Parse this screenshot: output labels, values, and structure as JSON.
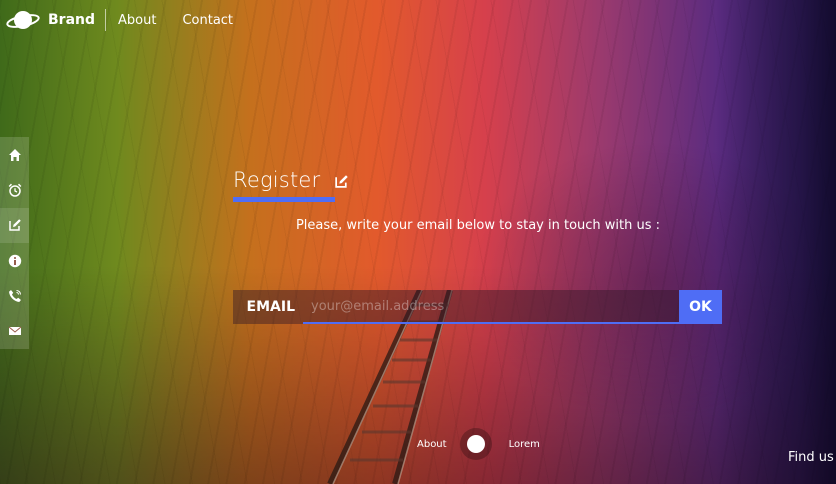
{
  "brand": {
    "name": "Brand",
    "logo": "planet-icon"
  },
  "nav": {
    "links": [
      "About",
      "Contact"
    ]
  },
  "sidebar": {
    "items": [
      {
        "icon": "home-icon"
      },
      {
        "icon": "alarm-clock-icon"
      },
      {
        "icon": "edit-icon"
      },
      {
        "icon": "info-icon"
      },
      {
        "icon": "phone-icon"
      },
      {
        "icon": "mail-icon"
      }
    ],
    "active_index": 2
  },
  "register": {
    "title": "Register",
    "icon": "edit-icon",
    "tagline": "Please, write your email below to stay in touch with us :"
  },
  "email_form": {
    "label": "EMAIL",
    "placeholder": "your@email.address",
    "value": "",
    "submit_label": "OK"
  },
  "bottom": {
    "left_label": "About",
    "right_label": "Lorem"
  },
  "footer": {
    "find_us": "Find us o"
  },
  "colors": {
    "accent": "#4f6df5",
    "text": "#ffffff"
  }
}
